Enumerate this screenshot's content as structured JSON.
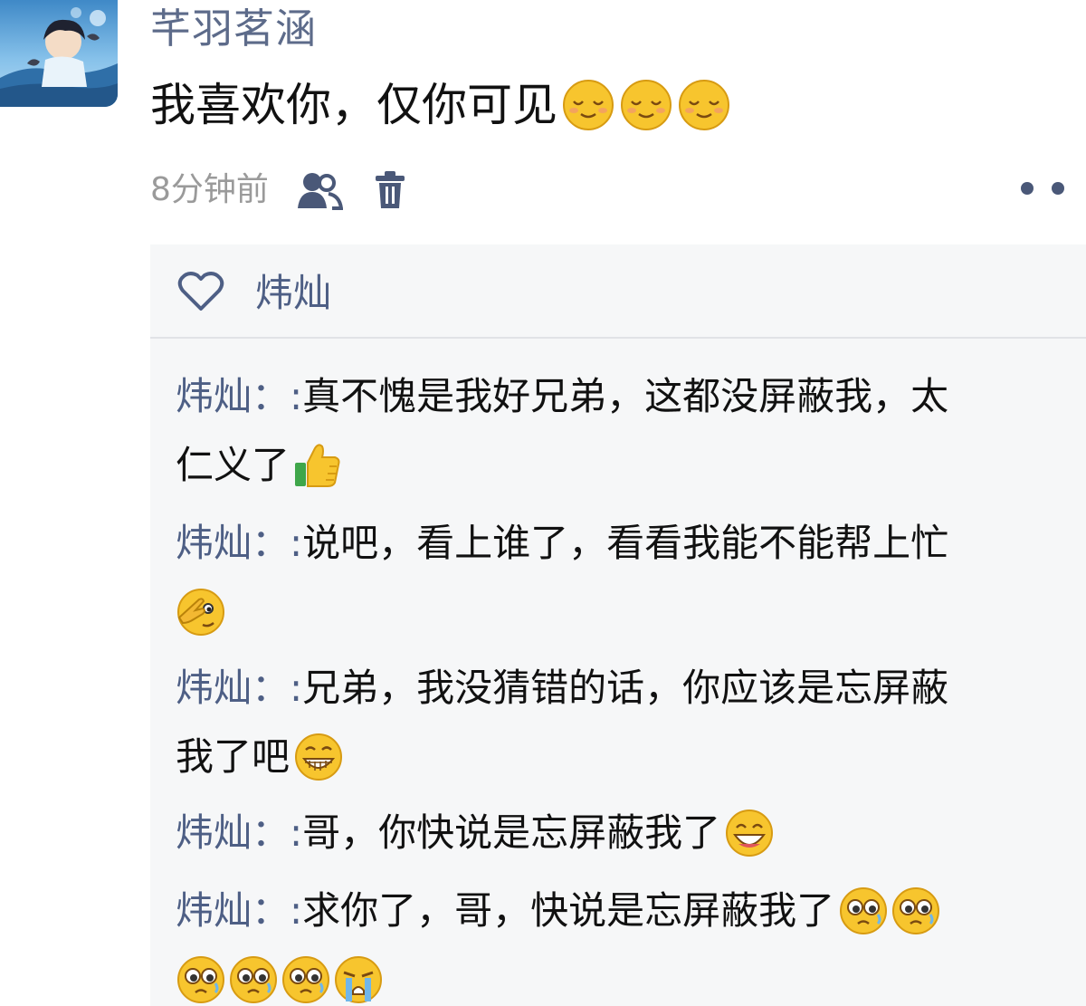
{
  "post": {
    "author": "芊羽茗涵",
    "text": "我喜欢你，仅你可见",
    "time": "8分钟前",
    "icons": [
      "visibility-users-icon",
      "trash-icon",
      "more-dots-icon"
    ],
    "text_emojis": [
      "shy-smile-emoji",
      "shy-smile-emoji",
      "shy-smile-emoji"
    ]
  },
  "likes": {
    "icon": "heart-outline-icon",
    "names": "炜灿"
  },
  "comments": [
    {
      "author": "炜灿",
      "separator": "：:",
      "line1": "真不愧是我好兄弟，这都没屏蔽我，太",
      "line2": "仁义了",
      "emojis": [
        "thumbs-up-emoji"
      ]
    },
    {
      "author": "炜灿",
      "separator": "：:",
      "line1": "说吧，看上谁了，看看我能不能帮上忙",
      "line2": "",
      "emojis": [
        "facepalm-emoji"
      ]
    },
    {
      "author": "炜灿",
      "separator": "：:",
      "line1": "兄弟，我没猜错的话，你应该是忘屏蔽",
      "line2": "我了吧",
      "emojis": [
        "grin-teeth-emoji"
      ]
    },
    {
      "author": "炜灿",
      "separator": "：:",
      "line1": "哥，你快说是忘屏蔽我了",
      "line2": "",
      "emojis": [
        "laugh-emoji"
      ]
    },
    {
      "author": "炜灿",
      "separator": "：:",
      "line1": "求你了，哥，快说是忘屏蔽我了",
      "line2": "",
      "emojis": [
        "pleading-emoji",
        "pleading-emoji",
        "pleading-emoji",
        "pleading-emoji",
        "pleading-emoji",
        "crying-emoji"
      ]
    }
  ],
  "colors": {
    "name_blue": "#4e5f85",
    "meta_gray": "#9a9a9a",
    "emoji_yellow": "#f7c52e",
    "comment_bg": "#f6f7f8"
  }
}
